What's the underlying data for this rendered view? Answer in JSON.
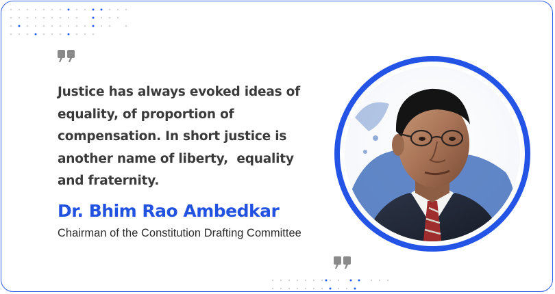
{
  "quote": {
    "lines": [
      "Justice has always evoked ideas of",
      "equality, of proportion of",
      "compensation. In short justice is",
      "another name of liberty,  equality",
      "and fraternity."
    ]
  },
  "author": {
    "name": "Dr. Bhim Rao Ambedkar",
    "role": "Chairman of the Constitution Drafting Committee"
  },
  "colors": {
    "accent": "#2152e0",
    "border": "#2a5be8",
    "quote_mark": "#8a8a8a",
    "text": "#3a3a3a"
  },
  "icons": {
    "open_quote": "quote-open-icon",
    "close_quote": "quote-close-icon",
    "portrait": "portrait-image"
  }
}
